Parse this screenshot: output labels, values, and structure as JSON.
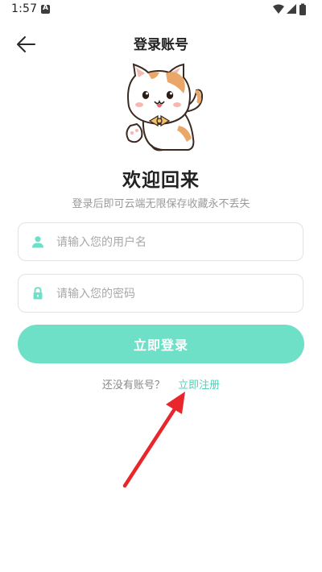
{
  "status_bar": {
    "time": "1:57",
    "notification_icon": "a-square-icon",
    "icons": [
      "wifi-icon",
      "signal-icon",
      "battery-icon"
    ]
  },
  "header": {
    "title": "登录账号",
    "back_icon": "arrow-left-icon"
  },
  "hero": {
    "mascot": "cat-mascot-icon",
    "welcome": "欢迎回来",
    "subtitle": "登录后即可云端无限保存收藏永不丢失"
  },
  "form": {
    "username": {
      "placeholder": "请输入您的用户名",
      "value": "",
      "icon": "user-icon"
    },
    "password": {
      "placeholder": "请输入您的密码",
      "value": "",
      "icon": "lock-icon"
    },
    "login_label": "立即登录"
  },
  "register": {
    "question": "还没有账号？",
    "link_label": "立即注册"
  },
  "colors": {
    "accent": "#6fe0c8",
    "link": "#4fd3b7",
    "annotation_arrow": "#e8262b"
  }
}
